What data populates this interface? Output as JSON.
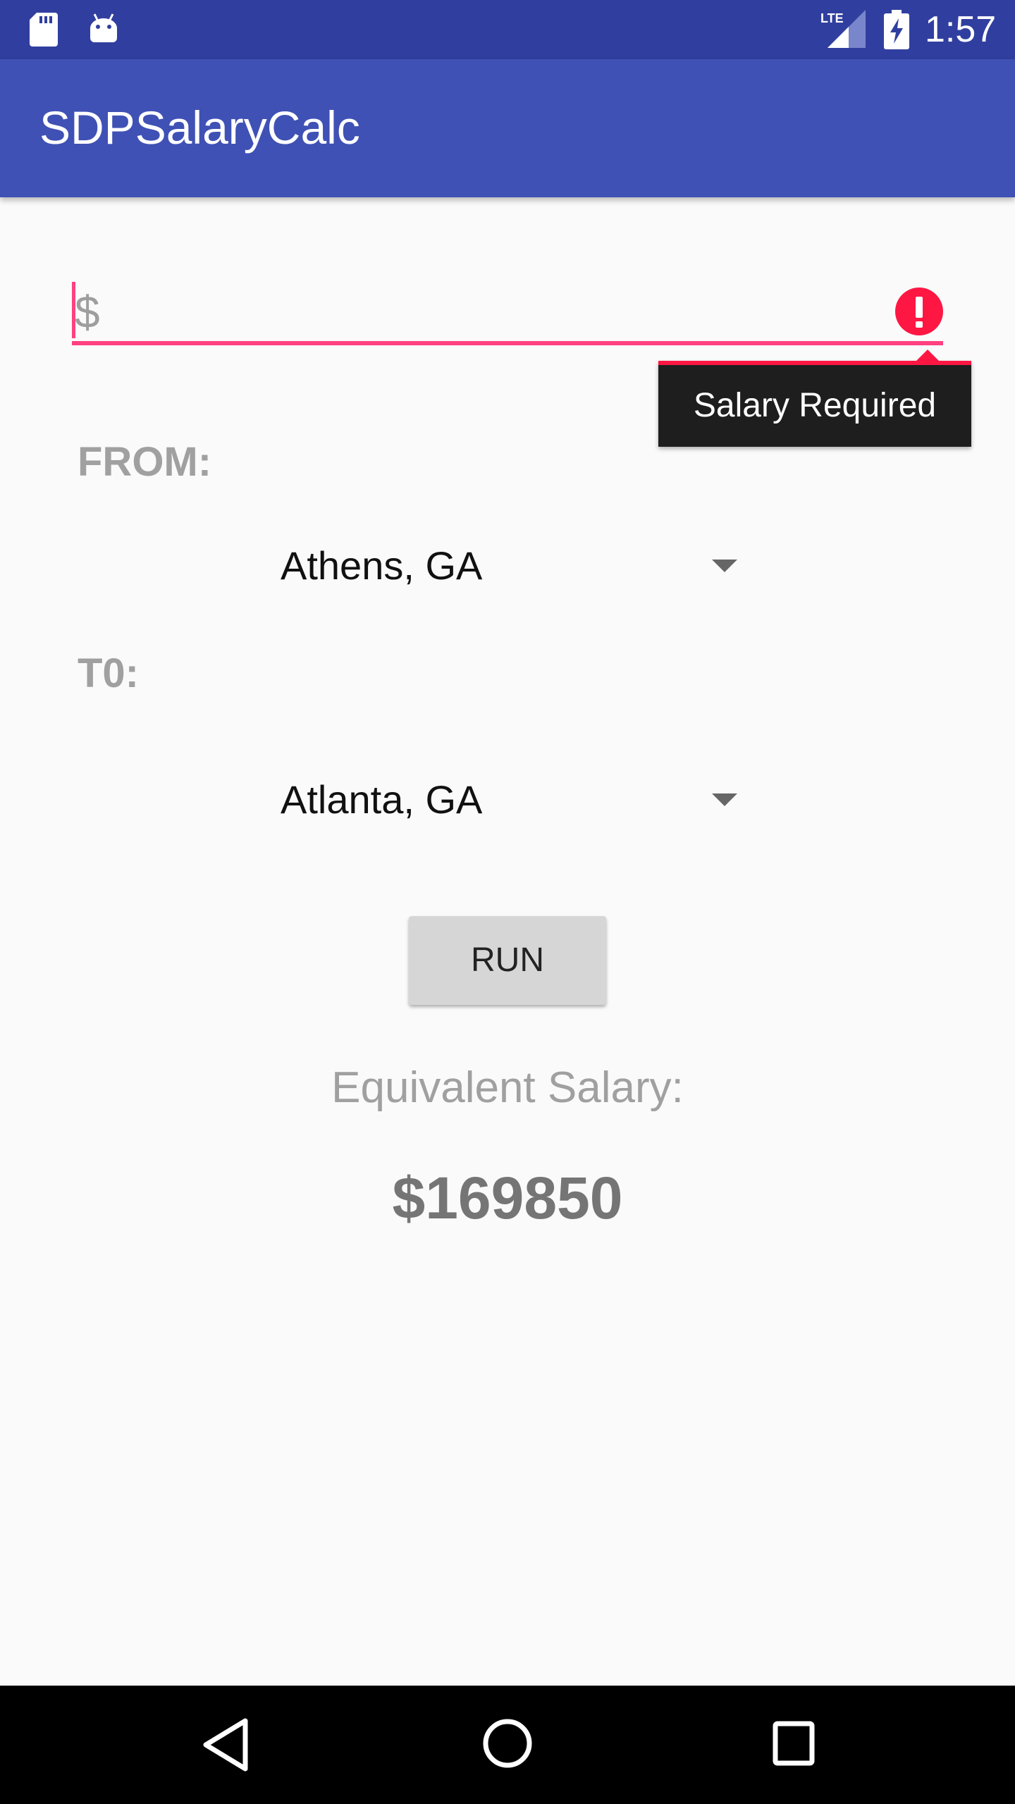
{
  "status_bar": {
    "time": "1:57",
    "network_label": "LTE",
    "icons": [
      "sd-card-icon",
      "android-icon",
      "lte-signal-icon",
      "battery-charging-icon"
    ]
  },
  "app_bar": {
    "title": "SDPSalaryCalc"
  },
  "salary_input": {
    "placeholder": "$",
    "value": "",
    "error_message": "Salary Required",
    "accent_color": "#ff4081",
    "error_color": "#ff1744"
  },
  "from": {
    "label": "FROM:",
    "selected": "Athens, GA"
  },
  "to": {
    "label": "T0:",
    "selected": "Atlanta, GA"
  },
  "run_button": {
    "label": "RUN"
  },
  "result": {
    "caption": "Equivalent Salary:",
    "value": "$169850"
  },
  "nav_bar": {
    "icons": [
      "back-icon",
      "home-icon",
      "recents-icon"
    ]
  },
  "colors": {
    "status_bar": "#303f9f",
    "app_bar": "#3f51b5",
    "background": "#fafafa",
    "nav_bar": "#000000"
  }
}
